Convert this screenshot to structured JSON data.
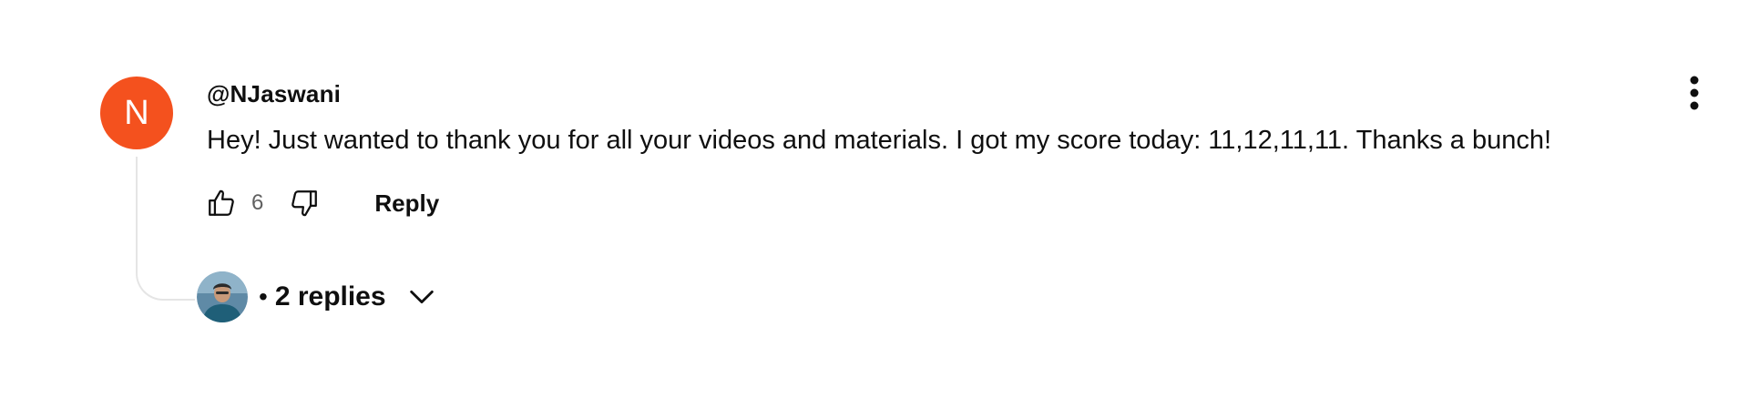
{
  "comment": {
    "avatar_letter": "N",
    "avatar_color": "#f4511e",
    "author": "@NJaswani",
    "text": "Hey! Just wanted to thank you for all your videos and materials. I got my score today: 11,12,11,11. Thanks a bunch!",
    "like_count": "6",
    "reply_label": "Reply",
    "replies_bullet": "•",
    "replies_label": "2 replies",
    "icons": {
      "like": "thumbs-up-icon",
      "dislike": "thumbs-down-icon",
      "more": "vertical-ellipsis-icon",
      "expand": "chevron-down-icon"
    }
  }
}
